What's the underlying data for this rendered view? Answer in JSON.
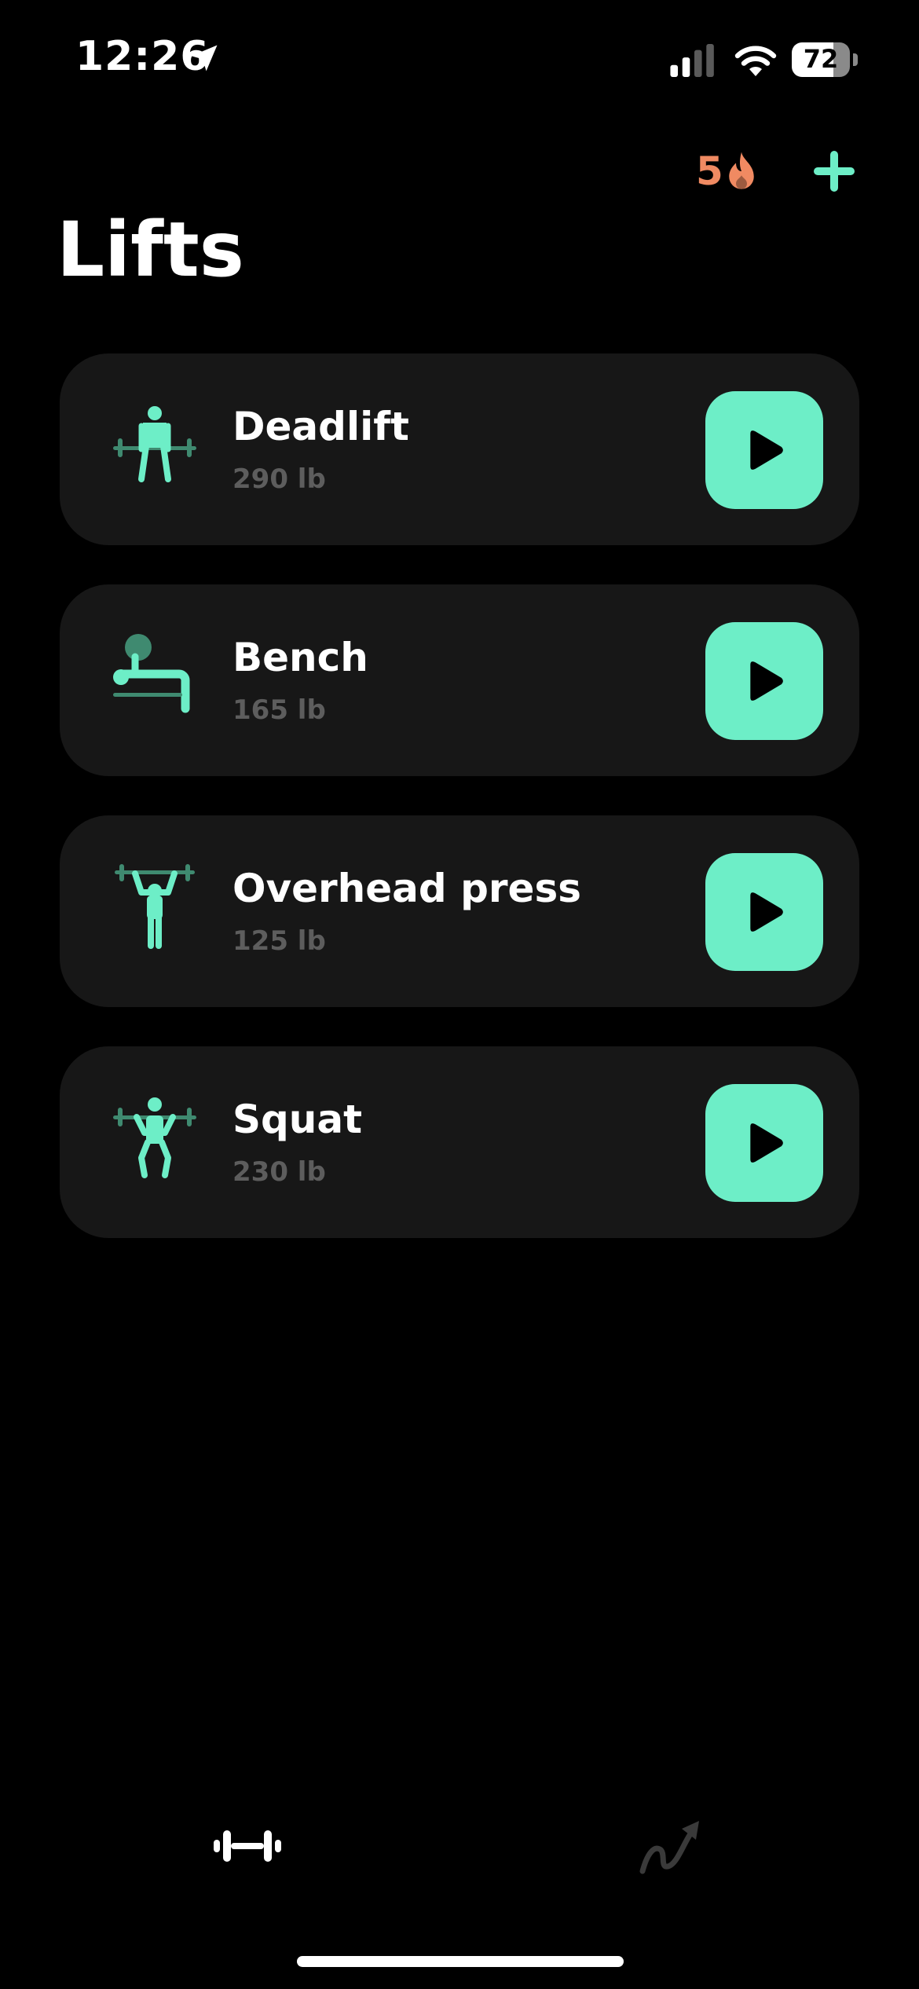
{
  "status_bar": {
    "time": "12:26",
    "battery": "72",
    "battery_level": 0.72
  },
  "header": {
    "streak_count": "5",
    "title": "Lifts"
  },
  "lifts": [
    {
      "name": "Deadlift",
      "weight": "290 lb",
      "icon": "deadlift-icon"
    },
    {
      "name": "Bench",
      "weight": "165 lb",
      "icon": "bench-press-icon"
    },
    {
      "name": "Overhead press",
      "weight": "125 lb",
      "icon": "overhead-press-icon"
    },
    {
      "name": "Squat",
      "weight": "230 lb",
      "icon": "squat-icon"
    }
  ],
  "tabs": [
    {
      "name": "lifts",
      "icon": "dumbbell-icon",
      "active": true
    },
    {
      "name": "progress",
      "icon": "trend-arrow-icon",
      "active": false
    }
  ],
  "colors": {
    "accent": "#6deec7",
    "accent_dark": "#3f8a70",
    "streak": "#f08a62",
    "card": "#171717",
    "secondary_text": "#5d5d5d",
    "inactive_tab": "#3a3a3a"
  }
}
